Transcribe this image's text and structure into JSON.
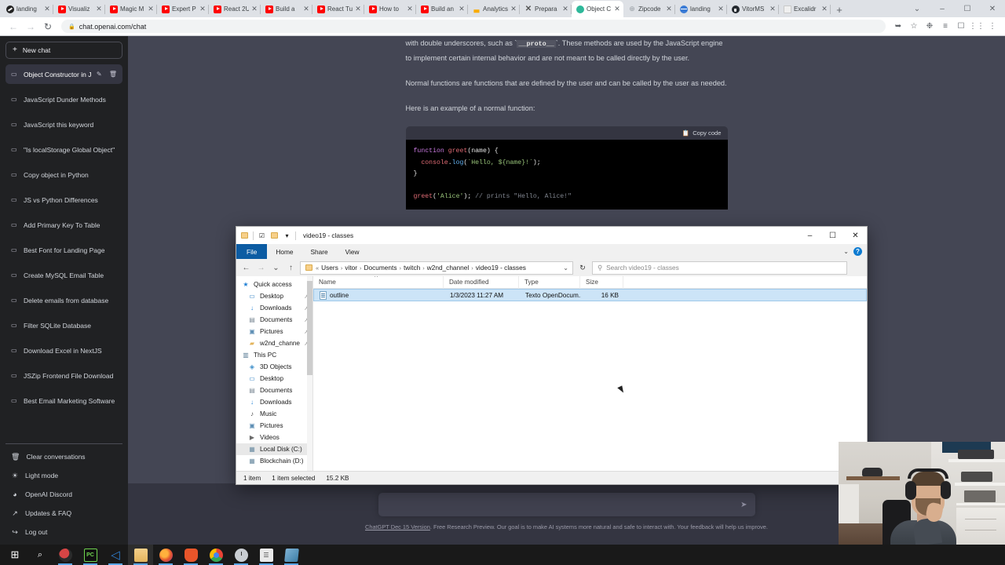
{
  "browser": {
    "tabs": [
      {
        "title": "landing",
        "icon": "dark-swirl-icon",
        "active": false
      },
      {
        "title": "Visualiz",
        "icon": "youtube-icon",
        "active": false
      },
      {
        "title": "Magic M",
        "icon": "youtube-icon",
        "active": false
      },
      {
        "title": "Expert P",
        "icon": "youtube-icon",
        "active": false
      },
      {
        "title": "React 2U",
        "icon": "youtube-icon",
        "active": false
      },
      {
        "title": "Build a",
        "icon": "youtube-icon",
        "active": false
      },
      {
        "title": "React Tu",
        "icon": "youtube-icon",
        "active": false
      },
      {
        "title": "How to",
        "icon": "youtube-icon",
        "active": false
      },
      {
        "title": "Build an",
        "icon": "youtube-icon",
        "active": false
      },
      {
        "title": "Analytics",
        "icon": "google-analytics-icon",
        "active": false
      },
      {
        "title": "Prepara",
        "icon": "x-letter-icon",
        "active": false
      },
      {
        "title": "Object C",
        "icon": "openai-icon",
        "active": true
      },
      {
        "title": "Zipcode",
        "icon": "globe-outline-icon",
        "active": false
      },
      {
        "title": "landing",
        "icon": "globe-icon",
        "active": false
      },
      {
        "title": "VitorMS",
        "icon": "github-icon",
        "active": false
      },
      {
        "title": "Excalidr",
        "icon": "excalidraw-icon",
        "active": false
      }
    ],
    "new_tab_label": "+",
    "window_controls": {
      "collapse": "⌄",
      "minimize": "–",
      "maximize": "☐",
      "close": "✕"
    },
    "nav": {
      "back": "←",
      "forward": "→",
      "reload": "↻"
    },
    "address": {
      "url": "chat.openai.com/chat",
      "lock": "🔒"
    },
    "toolbar_icons": [
      "share-icon",
      "bookmark-star-icon",
      "extensions-icon",
      "reading-list-icon",
      "sidebar-icon",
      "apps-grid-icon",
      "chrome-menu-icon"
    ]
  },
  "chatgpt": {
    "sidebar": {
      "new_chat_label": "New chat",
      "conversations": [
        {
          "title": "Object Constructor in J",
          "active": true
        },
        {
          "title": "JavaScript Dunder Methods",
          "active": false
        },
        {
          "title": "JavaScript this keyword",
          "active": false
        },
        {
          "title": "\"Is localStorage Global Object\"",
          "active": false
        },
        {
          "title": "Copy object in Python",
          "active": false
        },
        {
          "title": "JS vs Python Differences",
          "active": false
        },
        {
          "title": "Add Primary Key To Table",
          "active": false
        },
        {
          "title": "Best Font for Landing Page",
          "active": false
        },
        {
          "title": "Create MySQL Email Table",
          "active": false
        },
        {
          "title": "Delete emails from database",
          "active": false
        },
        {
          "title": "Filter SQLite Database",
          "active": false
        },
        {
          "title": "Download Excel in NextJS",
          "active": false
        },
        {
          "title": "JSZip Frontend File Download",
          "active": false
        },
        {
          "title": "Best Email Marketing Software",
          "active": false
        }
      ],
      "footer": [
        {
          "label": "Clear conversations",
          "icon": "trash-icon"
        },
        {
          "label": "Light mode",
          "icon": "sun-icon"
        },
        {
          "label": "OpenAI Discord",
          "icon": "discord-icon"
        },
        {
          "label": "Updates & FAQ",
          "icon": "external-link-icon"
        },
        {
          "label": "Log out",
          "icon": "logout-icon"
        }
      ]
    },
    "message": {
      "para1_pre": "with double underscores, such as ",
      "para1_code": "__proto__",
      "para1_post": ". These methods are used by the JavaScript engine to implement certain internal behavior and are not meant to be called directly by the user.",
      "para2": "Normal functions are functions that are defined by the user and can be called by the user as needed.",
      "para3": "Here is an example of a normal function:",
      "code_copy_label": "Copy code",
      "code_lines": {
        "l1_kw": "function",
        "l1_fn": "greet",
        "l1_rest": "(name) {",
        "l2_a": "  console",
        "l2_dot": ".",
        "l2_log": "log",
        "l2_open": "(",
        "l2_str": "`Hello, ${name}!`",
        "l2_end": ");",
        "l3": "}",
        "l5_fn": "greet",
        "l5_open": "(",
        "l5_str": "'Alice'",
        "l5_close": ");",
        "l5_comment": " // prints \"Hello, Alice!\""
      }
    },
    "composer": {
      "placeholder": "",
      "send_icon": "send-arrow-icon"
    },
    "disclaimer": {
      "link": "ChatGPT Dec 15 Version",
      "text": ". Free Research Preview. Our goal is to make AI systems more natural and safe to interact with. Your feedback will help us improve."
    }
  },
  "explorer": {
    "title": "video19 - classes",
    "quick_access_icons": [
      "folder-icon",
      "properties-icon",
      "new-folder-icon",
      "customize-caret-icon"
    ],
    "window_controls": {
      "minimize": "–",
      "maximize": "☐",
      "close": "✕"
    },
    "ribbon_tabs": [
      "File",
      "Home",
      "Share",
      "View"
    ],
    "ribbon_help": "?",
    "ribbon_chevron": "⌄",
    "address": {
      "back": "←",
      "forward": "→",
      "recent": "⌄",
      "up": "↑",
      "crumbs": [
        "Users",
        "vitor",
        "Documents",
        "twitch",
        "w2nd_channel",
        "video19 - classes"
      ],
      "separator": "›",
      "refresh": "↻"
    },
    "search": {
      "placeholder": "Search video19 - classes",
      "icon": "search-icon"
    },
    "nav_items": [
      {
        "label": "Quick access",
        "icon": "pin-icon",
        "pinned": false,
        "group": true,
        "indent": 0
      },
      {
        "label": "Desktop",
        "icon": "desktop-icon",
        "pinned": true,
        "indent": 1
      },
      {
        "label": "Downloads",
        "icon": "download-icon",
        "pinned": true,
        "indent": 1
      },
      {
        "label": "Documents",
        "icon": "documents-icon",
        "pinned": true,
        "indent": 1
      },
      {
        "label": "Pictures",
        "icon": "pictures-icon",
        "pinned": true,
        "indent": 1
      },
      {
        "label": "w2nd_channe",
        "icon": "folder-icon",
        "pinned": true,
        "indent": 1
      },
      {
        "label": "This PC",
        "icon": "thispc-icon",
        "pinned": false,
        "group": true,
        "indent": 0
      },
      {
        "label": "3D Objects",
        "icon": "3dobjects-icon",
        "pinned": false,
        "indent": 1
      },
      {
        "label": "Desktop",
        "icon": "desktop-icon",
        "pinned": false,
        "indent": 1
      },
      {
        "label": "Documents",
        "icon": "documents-icon",
        "pinned": false,
        "indent": 1
      },
      {
        "label": "Downloads",
        "icon": "download-icon",
        "pinned": false,
        "indent": 1
      },
      {
        "label": "Music",
        "icon": "music-icon",
        "pinned": false,
        "indent": 1
      },
      {
        "label": "Pictures",
        "icon": "pictures-icon",
        "pinned": false,
        "indent": 1
      },
      {
        "label": "Videos",
        "icon": "videos-icon",
        "pinned": false,
        "indent": 1
      },
      {
        "label": "Local Disk (C:)",
        "icon": "disk-icon",
        "pinned": false,
        "indent": 1,
        "selected": true
      },
      {
        "label": "Blockchain (D:)",
        "icon": "disk-icon",
        "pinned": false,
        "indent": 1
      }
    ],
    "columns": [
      "Name",
      "Date modified",
      "Type",
      "Size"
    ],
    "files": [
      {
        "name": "outline",
        "date": "1/3/2023 11:27 AM",
        "type": "Texto OpenDocum..",
        "size": "16 KB",
        "selected": true,
        "icon": "odt-document-icon"
      }
    ],
    "status": {
      "count": "1 item",
      "selected": "1 item selected",
      "size": "15.2 KB"
    }
  },
  "taskbar": {
    "items": [
      {
        "name": "start-button",
        "icon": "windows-icon",
        "active": false,
        "running": false
      },
      {
        "name": "search-button",
        "icon": "search-icon",
        "active": false,
        "running": false
      },
      {
        "name": "paint-app",
        "icon": "paint-icon",
        "active": false,
        "running": true
      },
      {
        "name": "pycharm-app",
        "icon": "pycharm-icon",
        "active": false,
        "running": true
      },
      {
        "name": "vscode-app",
        "icon": "vscode-icon",
        "active": false,
        "running": true
      },
      {
        "name": "file-explorer-app",
        "icon": "folder-icon",
        "active": true,
        "running": true
      },
      {
        "name": "firefox-app",
        "icon": "firefox-icon",
        "active": false,
        "running": true
      },
      {
        "name": "brave-app",
        "icon": "brave-icon",
        "active": false,
        "running": true
      },
      {
        "name": "chrome-app",
        "icon": "chrome-icon",
        "active": false,
        "running": true
      },
      {
        "name": "clock-app",
        "icon": "clock-icon",
        "active": false,
        "running": true
      },
      {
        "name": "notes-app",
        "icon": "notes-icon",
        "active": false,
        "running": true
      },
      {
        "name": "obs-app",
        "icon": "blue-app-icon",
        "active": false,
        "running": true
      }
    ]
  }
}
